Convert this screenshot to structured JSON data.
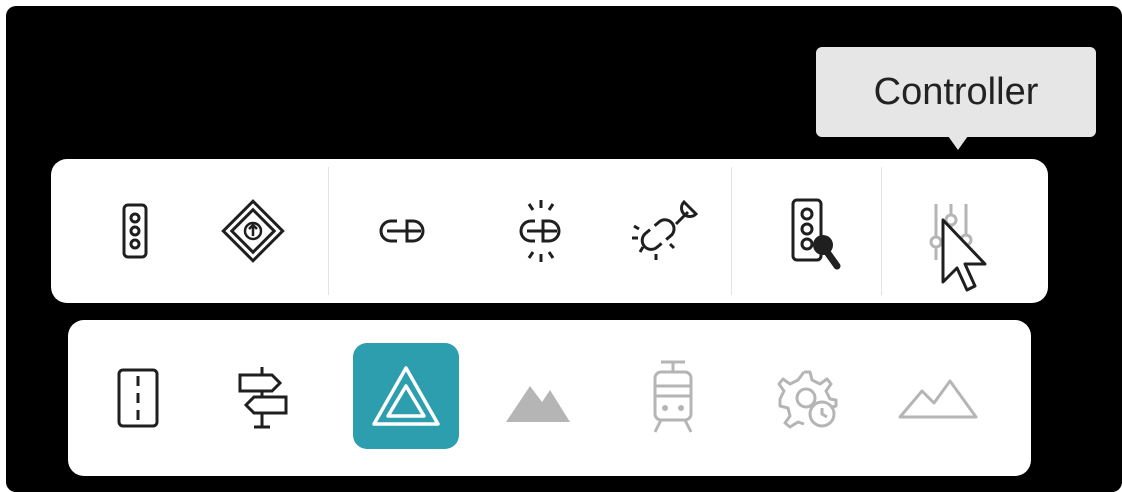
{
  "tooltip": {
    "text": "Controller"
  },
  "colors": {
    "icon": "#1f1f1f",
    "icon_disabled": "#b5b5b5",
    "active_bg": "#2c9eae",
    "active_icon": "#ffffff",
    "tooltip_bg": "#e6e6e6"
  },
  "top_toolbar": {
    "tools": [
      {
        "icon": "traffic-light-icon"
      },
      {
        "icon": "road-sign-diamond-icon"
      },
      {
        "icon": "link-icon"
      },
      {
        "icon": "link-break-icon"
      },
      {
        "icon": "link-repair-icon"
      },
      {
        "icon": "signal-plan-icon"
      },
      {
        "icon": "controller-sliders-icon"
      }
    ]
  },
  "bottom_toolbar": {
    "tools": [
      {
        "icon": "lane-icon"
      },
      {
        "icon": "signpost-icon"
      },
      {
        "icon": "hazard-triangle-icon",
        "selected": true
      },
      {
        "icon": "mountain-icon"
      },
      {
        "icon": "tram-icon"
      },
      {
        "icon": "gear-clock-icon"
      },
      {
        "icon": "terrain-icon"
      }
    ]
  }
}
